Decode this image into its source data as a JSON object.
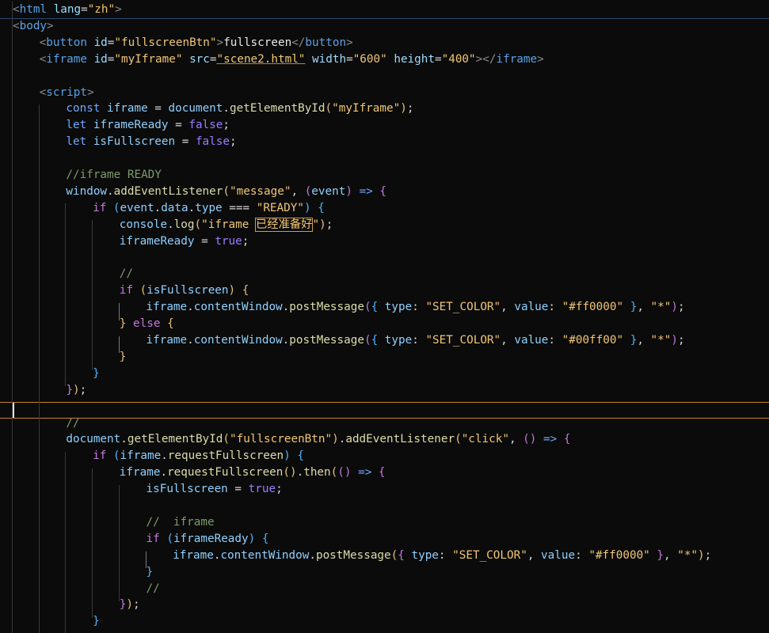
{
  "editor": {
    "lines": [
      {
        "n": 1,
        "indent": 0,
        "tokens": [
          [
            "t-brk",
            "<"
          ],
          [
            "t-tag",
            "html"
          ],
          [
            "t-pun",
            " "
          ],
          [
            "t-attr",
            "lang"
          ],
          [
            "t-pun",
            "="
          ],
          [
            "t-str",
            "\"zh\""
          ],
          [
            "t-brk",
            ">"
          ]
        ]
      },
      {
        "n": 2,
        "indent": 0,
        "tokens": [
          [
            "t-brk",
            "<"
          ],
          [
            "t-tag",
            "body"
          ],
          [
            "t-brk",
            ">"
          ]
        ]
      },
      {
        "n": 3,
        "indent": 1,
        "tokens": [
          [
            "t-brk",
            "<"
          ],
          [
            "t-tag",
            "button"
          ],
          [
            "t-pun",
            " "
          ],
          [
            "t-attr",
            "id"
          ],
          [
            "t-pun",
            "="
          ],
          [
            "t-str",
            "\"fullscreenBtn\""
          ],
          [
            "t-brk",
            ">"
          ],
          [
            "t-text",
            "fullscreen"
          ],
          [
            "t-brk",
            "</"
          ],
          [
            "t-tag",
            "button"
          ],
          [
            "t-brk",
            ">"
          ]
        ]
      },
      {
        "n": 4,
        "indent": 1,
        "tokens": [
          [
            "t-brk",
            "<"
          ],
          [
            "t-tag",
            "iframe"
          ],
          [
            "t-pun",
            " "
          ],
          [
            "t-attr",
            "id"
          ],
          [
            "t-pun",
            "="
          ],
          [
            "t-str",
            "\"myIframe\""
          ],
          [
            "t-pun",
            " "
          ],
          [
            "t-attr",
            "src"
          ],
          [
            "t-pun",
            "="
          ],
          [
            "t-str t-link",
            "\"scene2.html\""
          ],
          [
            "t-pun",
            " "
          ],
          [
            "t-attr",
            "width"
          ],
          [
            "t-pun",
            "="
          ],
          [
            "t-str",
            "\"600\""
          ],
          [
            "t-pun",
            " "
          ],
          [
            "t-attr",
            "height"
          ],
          [
            "t-pun",
            "="
          ],
          [
            "t-str",
            "\"400\""
          ],
          [
            "t-brk",
            "></"
          ],
          [
            "t-tag",
            "iframe"
          ],
          [
            "t-brk",
            ">"
          ]
        ]
      },
      {
        "n": 5,
        "indent": 0,
        "tokens": []
      },
      {
        "n": 6,
        "indent": 1,
        "tokens": [
          [
            "t-brk",
            "<"
          ],
          [
            "t-tag",
            "script"
          ],
          [
            "t-brk",
            ">"
          ]
        ]
      },
      {
        "n": 7,
        "indent": 2,
        "tokens": [
          [
            "t-kw",
            "const"
          ],
          [
            "t-pun",
            " "
          ],
          [
            "t-var",
            "iframe"
          ],
          [
            "t-pun",
            " = "
          ],
          [
            "t-var",
            "document"
          ],
          [
            "t-pun",
            "."
          ],
          [
            "t-fn",
            "getElementById"
          ],
          [
            "t-p1",
            "("
          ],
          [
            "t-str",
            "\"myIframe\""
          ],
          [
            "t-p1",
            ")"
          ],
          [
            "t-pun",
            ";"
          ]
        ]
      },
      {
        "n": 8,
        "indent": 2,
        "tokens": [
          [
            "t-kw",
            "let"
          ],
          [
            "t-pun",
            " "
          ],
          [
            "t-var",
            "iframeReady"
          ],
          [
            "t-pun",
            " = "
          ],
          [
            "t-bool",
            "false"
          ],
          [
            "t-pun",
            ";"
          ]
        ]
      },
      {
        "n": 9,
        "indent": 2,
        "tokens": [
          [
            "t-kw",
            "let"
          ],
          [
            "t-pun",
            " "
          ],
          [
            "t-var",
            "isFullscreen"
          ],
          [
            "t-pun",
            " = "
          ],
          [
            "t-bool",
            "false"
          ],
          [
            "t-pun",
            ";"
          ]
        ]
      },
      {
        "n": 10,
        "indent": 0,
        "tokens": []
      },
      {
        "n": 11,
        "indent": 2,
        "tokens": [
          [
            "t-cmt",
            "//iframe READY"
          ]
        ]
      },
      {
        "n": 12,
        "indent": 2,
        "tokens": [
          [
            "t-var",
            "window"
          ],
          [
            "t-pun",
            "."
          ],
          [
            "t-fn",
            "addEventListener"
          ],
          [
            "t-p1",
            "("
          ],
          [
            "t-str",
            "\"message\""
          ],
          [
            "t-pun",
            ", "
          ],
          [
            "t-p2",
            "("
          ],
          [
            "t-var",
            "event"
          ],
          [
            "t-p2",
            ")"
          ],
          [
            "t-pun",
            " "
          ],
          [
            "t-kw",
            "=>"
          ],
          [
            "t-pun",
            " "
          ],
          [
            "t-p2",
            "{"
          ]
        ]
      },
      {
        "n": 13,
        "indent": 3,
        "tokens": [
          [
            "t-kw2",
            "if"
          ],
          [
            "t-pun",
            " "
          ],
          [
            "t-p3",
            "("
          ],
          [
            "t-var",
            "event"
          ],
          [
            "t-pun",
            "."
          ],
          [
            "t-var",
            "data"
          ],
          [
            "t-pun",
            "."
          ],
          [
            "t-var",
            "type"
          ],
          [
            "t-pun",
            " === "
          ],
          [
            "t-str",
            "\"READY\""
          ],
          [
            "t-p3",
            ")"
          ],
          [
            "t-pun",
            " "
          ],
          [
            "t-p3",
            "{"
          ]
        ]
      },
      {
        "n": 14,
        "indent": 4,
        "tokens": [
          [
            "t-var",
            "console"
          ],
          [
            "t-pun",
            "."
          ],
          [
            "t-fn",
            "log"
          ],
          [
            "t-p1",
            "("
          ],
          [
            "t-str",
            "\"iframe "
          ],
          [
            "t-str highlight-box",
            "已经准备好"
          ],
          [
            "t-str",
            "\""
          ],
          [
            "t-p1",
            ")"
          ],
          [
            "t-pun",
            ";"
          ]
        ]
      },
      {
        "n": 15,
        "indent": 4,
        "tokens": [
          [
            "t-var",
            "iframeReady"
          ],
          [
            "t-pun",
            " = "
          ],
          [
            "t-bool",
            "true"
          ],
          [
            "t-pun",
            ";"
          ]
        ]
      },
      {
        "n": 16,
        "indent": 0,
        "tokens": []
      },
      {
        "n": 17,
        "indent": 4,
        "tokens": [
          [
            "t-cmt",
            "//"
          ]
        ]
      },
      {
        "n": 18,
        "indent": 4,
        "tokens": [
          [
            "t-kw2",
            "if"
          ],
          [
            "t-pun",
            " "
          ],
          [
            "t-p1",
            "("
          ],
          [
            "t-var",
            "isFullscreen"
          ],
          [
            "t-p1",
            ")"
          ],
          [
            "t-pun",
            " "
          ],
          [
            "t-p1",
            "{"
          ]
        ]
      },
      {
        "n": 19,
        "indent": 5,
        "tokens": [
          [
            "t-var",
            "iframe"
          ],
          [
            "t-pun",
            "."
          ],
          [
            "t-var",
            "contentWindow"
          ],
          [
            "t-pun",
            "."
          ],
          [
            "t-fn",
            "postMessage"
          ],
          [
            "t-p2",
            "("
          ],
          [
            "t-p3",
            "{"
          ],
          [
            "t-pun",
            " "
          ],
          [
            "t-var",
            "type"
          ],
          [
            "t-pun",
            ": "
          ],
          [
            "t-str",
            "\"SET_COLOR\""
          ],
          [
            "t-pun",
            ", "
          ],
          [
            "t-var",
            "value"
          ],
          [
            "t-pun",
            ": "
          ],
          [
            "t-str",
            "\"#ff0000\""
          ],
          [
            "t-pun",
            " "
          ],
          [
            "t-p3",
            "}"
          ],
          [
            "t-pun",
            ", "
          ],
          [
            "t-str",
            "\"*\""
          ],
          [
            "t-p2",
            ")"
          ],
          [
            "t-pun",
            ";"
          ]
        ]
      },
      {
        "n": 20,
        "indent": 4,
        "tokens": [
          [
            "t-p1",
            "}"
          ],
          [
            "t-pun",
            " "
          ],
          [
            "t-kw2",
            "else"
          ],
          [
            "t-pun",
            " "
          ],
          [
            "t-p1",
            "{"
          ]
        ]
      },
      {
        "n": 21,
        "indent": 5,
        "tokens": [
          [
            "t-var",
            "iframe"
          ],
          [
            "t-pun",
            "."
          ],
          [
            "t-var",
            "contentWindow"
          ],
          [
            "t-pun",
            "."
          ],
          [
            "t-fn",
            "postMessage"
          ],
          [
            "t-p2",
            "("
          ],
          [
            "t-p3",
            "{"
          ],
          [
            "t-pun",
            " "
          ],
          [
            "t-var",
            "type"
          ],
          [
            "t-pun",
            ": "
          ],
          [
            "t-str",
            "\"SET_COLOR\""
          ],
          [
            "t-pun",
            ", "
          ],
          [
            "t-var",
            "value"
          ],
          [
            "t-pun",
            ": "
          ],
          [
            "t-str",
            "\"#00ff00\""
          ],
          [
            "t-pun",
            " "
          ],
          [
            "t-p3",
            "}"
          ],
          [
            "t-pun",
            ", "
          ],
          [
            "t-str",
            "\"*\""
          ],
          [
            "t-p2",
            ")"
          ],
          [
            "t-pun",
            ";"
          ]
        ]
      },
      {
        "n": 22,
        "indent": 4,
        "tokens": [
          [
            "t-p1",
            "}"
          ]
        ]
      },
      {
        "n": 23,
        "indent": 3,
        "tokens": [
          [
            "t-p3",
            "}"
          ]
        ]
      },
      {
        "n": 24,
        "indent": 2,
        "tokens": [
          [
            "t-p2",
            "}"
          ],
          [
            "t-p1",
            ")"
          ],
          [
            "t-pun",
            ";"
          ]
        ]
      },
      {
        "n": 25,
        "indent": 0,
        "tokens": []
      },
      {
        "n": 26,
        "indent": 2,
        "tokens": [
          [
            "t-cmt",
            "//"
          ]
        ]
      },
      {
        "n": 27,
        "indent": 2,
        "tokens": [
          [
            "t-var",
            "document"
          ],
          [
            "t-pun",
            "."
          ],
          [
            "t-fn",
            "getElementById"
          ],
          [
            "t-p1",
            "("
          ],
          [
            "t-str",
            "\"fullscreenBtn\""
          ],
          [
            "t-p1",
            ")"
          ],
          [
            "t-pun",
            "."
          ],
          [
            "t-fn",
            "addEventListener"
          ],
          [
            "t-p1",
            "("
          ],
          [
            "t-str",
            "\"click\""
          ],
          [
            "t-pun",
            ", "
          ],
          [
            "t-p2",
            "()"
          ],
          [
            "t-pun",
            " "
          ],
          [
            "t-kw",
            "=>"
          ],
          [
            "t-pun",
            " "
          ],
          [
            "t-p2",
            "{"
          ]
        ]
      },
      {
        "n": 28,
        "indent": 3,
        "tokens": [
          [
            "t-kw2",
            "if"
          ],
          [
            "t-pun",
            " "
          ],
          [
            "t-p3",
            "("
          ],
          [
            "t-var",
            "iframe"
          ],
          [
            "t-pun",
            "."
          ],
          [
            "t-fn",
            "requestFullscreen"
          ],
          [
            "t-p3",
            ")"
          ],
          [
            "t-pun",
            " "
          ],
          [
            "t-p3",
            "{"
          ]
        ]
      },
      {
        "n": 29,
        "indent": 4,
        "tokens": [
          [
            "t-var",
            "iframe"
          ],
          [
            "t-pun",
            "."
          ],
          [
            "t-fn",
            "requestFullscreen"
          ],
          [
            "t-p1",
            "()"
          ],
          [
            "t-pun",
            "."
          ],
          [
            "t-fn",
            "then"
          ],
          [
            "t-p1",
            "("
          ],
          [
            "t-p2",
            "()"
          ],
          [
            "t-pun",
            " "
          ],
          [
            "t-kw",
            "=>"
          ],
          [
            "t-pun",
            " "
          ],
          [
            "t-p2",
            "{"
          ]
        ]
      },
      {
        "n": 30,
        "indent": 5,
        "tokens": [
          [
            "t-var",
            "isFullscreen"
          ],
          [
            "t-pun",
            " = "
          ],
          [
            "t-bool",
            "true"
          ],
          [
            "t-pun",
            ";"
          ]
        ]
      },
      {
        "n": 31,
        "indent": 0,
        "tokens": []
      },
      {
        "n": 32,
        "indent": 5,
        "tokens": [
          [
            "t-cmt",
            "//  iframe"
          ]
        ]
      },
      {
        "n": 33,
        "indent": 5,
        "tokens": [
          [
            "t-kw2",
            "if"
          ],
          [
            "t-pun",
            " "
          ],
          [
            "t-p3",
            "("
          ],
          [
            "t-var",
            "iframeReady"
          ],
          [
            "t-p3",
            ")"
          ],
          [
            "t-pun",
            " "
          ],
          [
            "t-p3",
            "{"
          ]
        ]
      },
      {
        "n": 34,
        "indent": 6,
        "tokens": [
          [
            "t-var",
            "iframe"
          ],
          [
            "t-pun",
            "."
          ],
          [
            "t-var",
            "contentWindow"
          ],
          [
            "t-pun",
            "."
          ],
          [
            "t-fn",
            "postMessage"
          ],
          [
            "t-p1",
            "("
          ],
          [
            "t-p2",
            "{"
          ],
          [
            "t-pun",
            " "
          ],
          [
            "t-var",
            "type"
          ],
          [
            "t-pun",
            ": "
          ],
          [
            "t-str",
            "\"SET_COLOR\""
          ],
          [
            "t-pun",
            ", "
          ],
          [
            "t-var",
            "value"
          ],
          [
            "t-pun",
            ": "
          ],
          [
            "t-str",
            "\"#ff0000\""
          ],
          [
            "t-pun",
            " "
          ],
          [
            "t-p2",
            "}"
          ],
          [
            "t-pun",
            ", "
          ],
          [
            "t-str",
            "\"*\""
          ],
          [
            "t-p1",
            ")"
          ],
          [
            "t-pun",
            ";"
          ]
        ]
      },
      {
        "n": 35,
        "indent": 5,
        "tokens": [
          [
            "t-p3",
            "}"
          ]
        ]
      },
      {
        "n": 36,
        "indent": 5,
        "tokens": [
          [
            "t-cmt",
            "//"
          ]
        ]
      },
      {
        "n": 37,
        "indent": 4,
        "tokens": [
          [
            "t-p2",
            "}"
          ],
          [
            "t-p1",
            ")"
          ],
          [
            "t-pun",
            ";"
          ]
        ]
      },
      {
        "n": 38,
        "indent": 3,
        "tokens": [
          [
            "t-p3",
            "}"
          ]
        ]
      }
    ]
  }
}
